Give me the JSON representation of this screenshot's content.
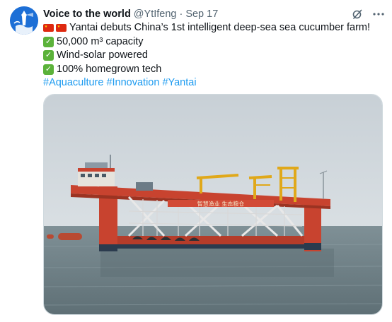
{
  "author": {
    "name": "Voice to the world",
    "handle": "@YtIfeng",
    "separator": "·",
    "date": "Sep 17"
  },
  "icons": {
    "avatar": "lighthouse-avatar",
    "grok": "grok-slash-icon",
    "more": "more-dots-icon",
    "flag": "china-flag-emoji",
    "check": "check-mark-emoji"
  },
  "tweet": {
    "headline": "Yantai debuts China’s 1st intelligent deep-sea sea cucumber farm!",
    "points": [
      "50,000 m³ capacity",
      "Wind-solar powered",
      "100% homegrown tech"
    ],
    "hashtags": [
      "#Aquaculture",
      "#Innovation",
      "#Yantai"
    ]
  },
  "media": {
    "banner_text": "智慧渔业 生态粮仓"
  },
  "colors": {
    "link": "#1d9bf0",
    "secondary_text": "#536471",
    "platform_red": "#c8432f",
    "crane_yellow": "#e0a81a",
    "sea": "#6a7d84",
    "sky": "#cfd7de"
  }
}
